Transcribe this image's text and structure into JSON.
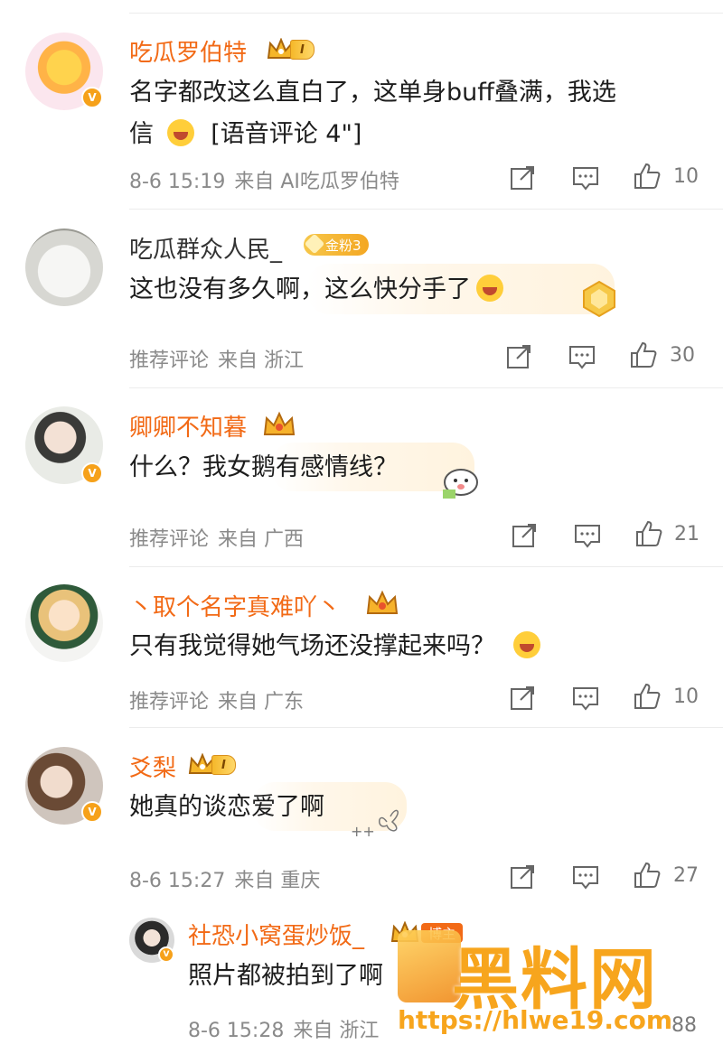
{
  "comments": [
    {
      "username": "吃瓜罗伯特",
      "level": "I",
      "text_line1": "名字都改这么直白了，这单身buff叠满，我选",
      "text_line2": "信",
      "text_line2_tail": "[语音评论 4\"]",
      "meta": [
        "8-6 15:19",
        "来自 AI吃瓜罗伯特"
      ],
      "likes": "10"
    },
    {
      "username": "吃瓜群众人民_",
      "fan_badge": "金粉3",
      "text": "这也没有多久啊，这么快分手了",
      "meta": [
        "推荐评论",
        "来自 浙江"
      ],
      "likes": "30"
    },
    {
      "username": "卿卿不知暮",
      "text": "什么？我女鹅有感情线？",
      "meta": [
        "推荐评论",
        "来自 广西"
      ],
      "likes": "21"
    },
    {
      "username": "丶取个名字真难吖丶",
      "text": "只有我觉得她气场还没撑起来吗？",
      "meta": [
        "推荐评论",
        "来自 广东"
      ],
      "likes": "10"
    },
    {
      "username": "爻梨",
      "level": "I",
      "text": "她真的谈恋爱了啊",
      "meta": [
        "8-6 15:27",
        "来自 重庆"
      ],
      "likes": "27"
    }
  ],
  "reply": {
    "username": "社恐小窝蛋炒饭_",
    "host_badge": "博主",
    "text": "照片都被拍到了啊",
    "meta": [
      "8-6 15:28",
      "来自 浙江"
    ],
    "likes": "88"
  },
  "watermark": {
    "brand": "黑料网",
    "url": "https://hlwe19.com"
  },
  "colors": {
    "username": "#f26a16",
    "meta": "#8a8a8a",
    "watermark": "#f7a51d"
  },
  "icons": [
    "share-icon",
    "comment-icon",
    "like-icon",
    "verified-icon",
    "crown-icon"
  ]
}
